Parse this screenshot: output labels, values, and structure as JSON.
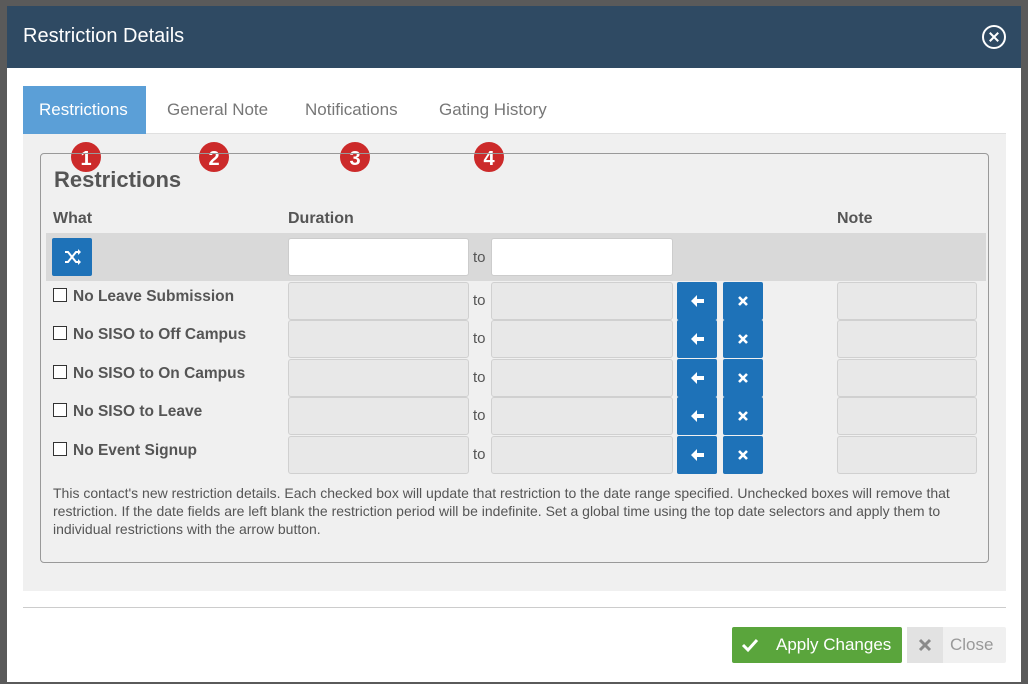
{
  "modal": {
    "title": "Restriction Details"
  },
  "tabs": [
    {
      "label": "Restrictions",
      "active": true,
      "badge": "1"
    },
    {
      "label": "General Note",
      "badge": "2"
    },
    {
      "label": "Notifications",
      "badge": "3"
    },
    {
      "label": "Gating History",
      "badge": "4"
    }
  ],
  "section": {
    "title": "Restrictions"
  },
  "columns": {
    "what": "What",
    "duration": "Duration",
    "note": "Note"
  },
  "global": {
    "to": "to",
    "from_value": "",
    "to_value": ""
  },
  "rows": [
    {
      "label": "No Leave Submission",
      "to": "to",
      "checked": false
    },
    {
      "label": "No SISO to Off Campus",
      "to": "to",
      "checked": false
    },
    {
      "label": "No SISO to On Campus",
      "to": "to",
      "checked": false
    },
    {
      "label": "No SISO to Leave",
      "to": "to",
      "checked": false
    },
    {
      "label": "No Event Signup",
      "to": "to",
      "checked": false
    }
  ],
  "help_text": "This contact's new restriction details. Each checked box will update that restriction to the date range specified. Unchecked boxes will remove that restriction. If the date fields are left blank the restriction period will be indefinite. Set a global time using the top date selectors and apply them to individual restrictions with the arrow button.",
  "footer": {
    "apply_label": "Apply Changes",
    "close_label": "Close"
  },
  "colors": {
    "header": "#2f4a63",
    "accent": "#1e72b8",
    "success": "#5aa53c",
    "badge": "#cc2a2a",
    "active_tab": "#5b9fd7"
  },
  "icons": {
    "close": "close-circle-icon",
    "shuffle": "shuffle-icon",
    "apply": "arrow-left-icon",
    "clear": "x-icon",
    "check": "check-icon"
  }
}
